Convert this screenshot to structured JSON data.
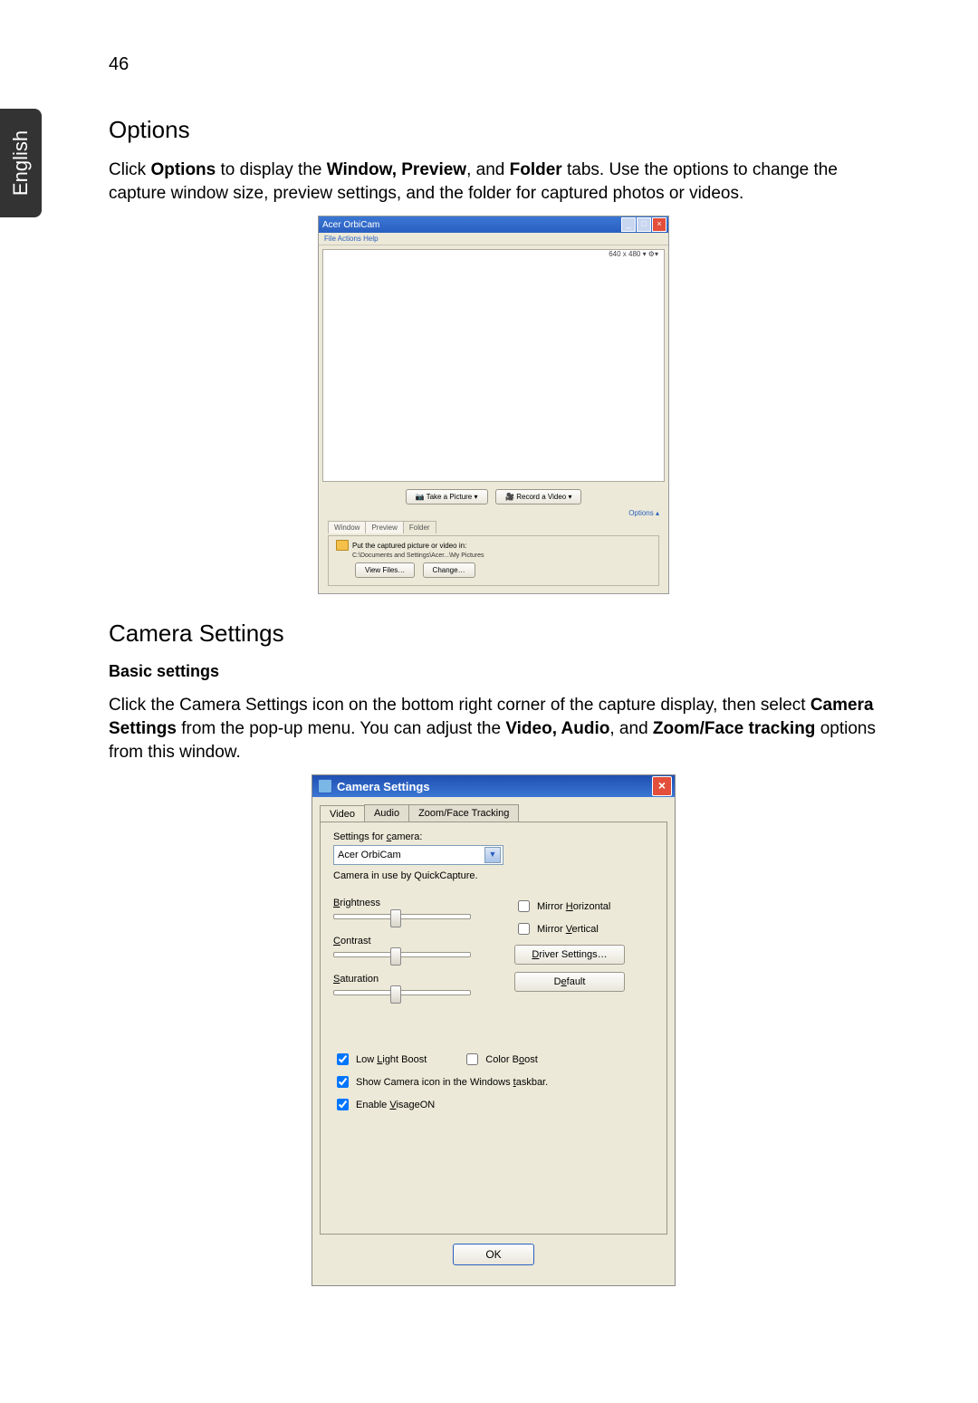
{
  "page_number": "46",
  "language_tab": "English",
  "section_options": {
    "heading": "Options",
    "paragraph_parts": [
      "Click ",
      "Options",
      " to display the ",
      "Window, Preview",
      ", and ",
      "Folder",
      " tabs. Use the options to change the capture window size, preview settings, and the folder for captured photos or videos."
    ]
  },
  "orbicam_window": {
    "title": "Acer OrbiCam",
    "menu": "File   Actions   Help",
    "status_resolution": "640 x 480 ▾  ⚙▾",
    "take_picture": "Take a Picture",
    "record_video": "Record a Video",
    "options_link": "Options  ▴",
    "tabs": {
      "window": "Window",
      "preview": "Preview",
      "folder": "Folder"
    },
    "folder_caption": "Put the captured picture or video in:",
    "folder_path": "C:\\Documents and Settings\\Acer...\\My Pictures",
    "view_files": "View Files…",
    "change": "Change…"
  },
  "section_camera": {
    "heading": "Camera Settings",
    "subheading": "Basic settings",
    "paragraph_parts": [
      "Click the Camera Settings icon on the bottom right corner of the capture display, then select ",
      "Camera Settings",
      " from the pop-up menu. You can adjust the ",
      "Video, Audio",
      ", and ",
      "Zoom/Face tracking",
      " options from this window."
    ]
  },
  "camset_dialog": {
    "title": "Camera Settings",
    "tabs": {
      "video": "Video",
      "audio": "Audio",
      "zoom": "Zoom/Face Tracking"
    },
    "settings_for_camera_label": "Settings for camera:",
    "camera_name": "Acer OrbiCam",
    "in_use_line": "Camera in use by QuickCapture.",
    "brightness_label": "Brightness",
    "contrast_label": "Contrast",
    "saturation_label": "Saturation",
    "mirror_h": "Mirror Horizontal",
    "mirror_v": "Mirror Vertical",
    "driver_settings": "Driver Settings…",
    "default_btn": "Default",
    "low_light": "Low Light Boost",
    "color_boost": "Color Boost",
    "show_taskbar": "Show Camera icon in the Windows taskbar.",
    "enable_visage": "Enable VisageON",
    "ok": "OK"
  }
}
